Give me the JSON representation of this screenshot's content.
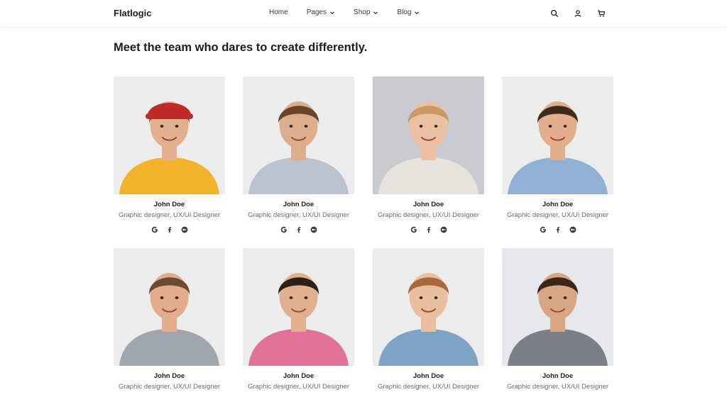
{
  "brand": {
    "name": "Flatlogic"
  },
  "nav": {
    "items": [
      {
        "label": "Home",
        "dropdown": false
      },
      {
        "label": "Pages",
        "dropdown": true
      },
      {
        "label": "Shop",
        "dropdown": true
      },
      {
        "label": "Blog",
        "dropdown": true
      }
    ],
    "icons": [
      "search-icon",
      "user-icon",
      "cart-icon"
    ]
  },
  "heading": "Meet the team who dares to create differently.",
  "team": [
    {
      "name": "John Doe",
      "role": "Graphic designer, UX/UI Designer",
      "bg": "#ececec",
      "shirt": "#f2b32b",
      "hair": "#8a5a34",
      "skin": "#e3b08f",
      "hat": "#c12a2a",
      "socials": [
        "google-icon",
        "facebook-icon",
        "medium-icon"
      ]
    },
    {
      "name": "John Doe",
      "role": "Graphic designer, UX/UI Designer",
      "bg": "#ececec",
      "shirt": "#b9c3d0",
      "hair": "#6b4528",
      "skin": "#dcae8e",
      "socials": [
        "google-icon",
        "facebook-icon",
        "medium-icon"
      ]
    },
    {
      "name": "John Doe",
      "role": "Graphic designer, UX/UI Designer",
      "bg": "#c9cbd1",
      "shirt": "#e6e3dc",
      "hair": "#c99a63",
      "skin": "#ecc1a3",
      "socials": [
        "google-icon",
        "facebook-icon",
        "medium-icon"
      ]
    },
    {
      "name": "John Doe",
      "role": "Graphic designer, UX/UI Designer",
      "bg": "#ececec",
      "shirt": "#8fb2d4",
      "hair": "#3f2a1e",
      "skin": "#e2ae8c",
      "socials": [
        "google-icon",
        "facebook-icon",
        "medium-icon"
      ]
    },
    {
      "name": "John Doe",
      "role": "Graphic designer, UX/UI Designer",
      "bg": "#ececec",
      "shirt": "#9fa6ad",
      "hair": "#6a4a33",
      "skin": "#e1ad8c"
    },
    {
      "name": "John Doe",
      "role": "Graphic designer, UX/UI Designer",
      "bg": "#ececec",
      "shirt": "#e2729a",
      "hair": "#2e1f18",
      "skin": "#e0b08f"
    },
    {
      "name": "John Doe",
      "role": "Graphic designer, UX/UI Designer",
      "bg": "#ececec",
      "shirt": "#7fa2c7",
      "hair": "#a86a3c",
      "skin": "#eabf9f"
    },
    {
      "name": "John Doe",
      "role": "Graphic designer, UX/UI Designer",
      "bg": "#e6e8ec",
      "shirt": "#7b7f86",
      "hair": "#3a2619",
      "skin": "#d9a684"
    }
  ]
}
